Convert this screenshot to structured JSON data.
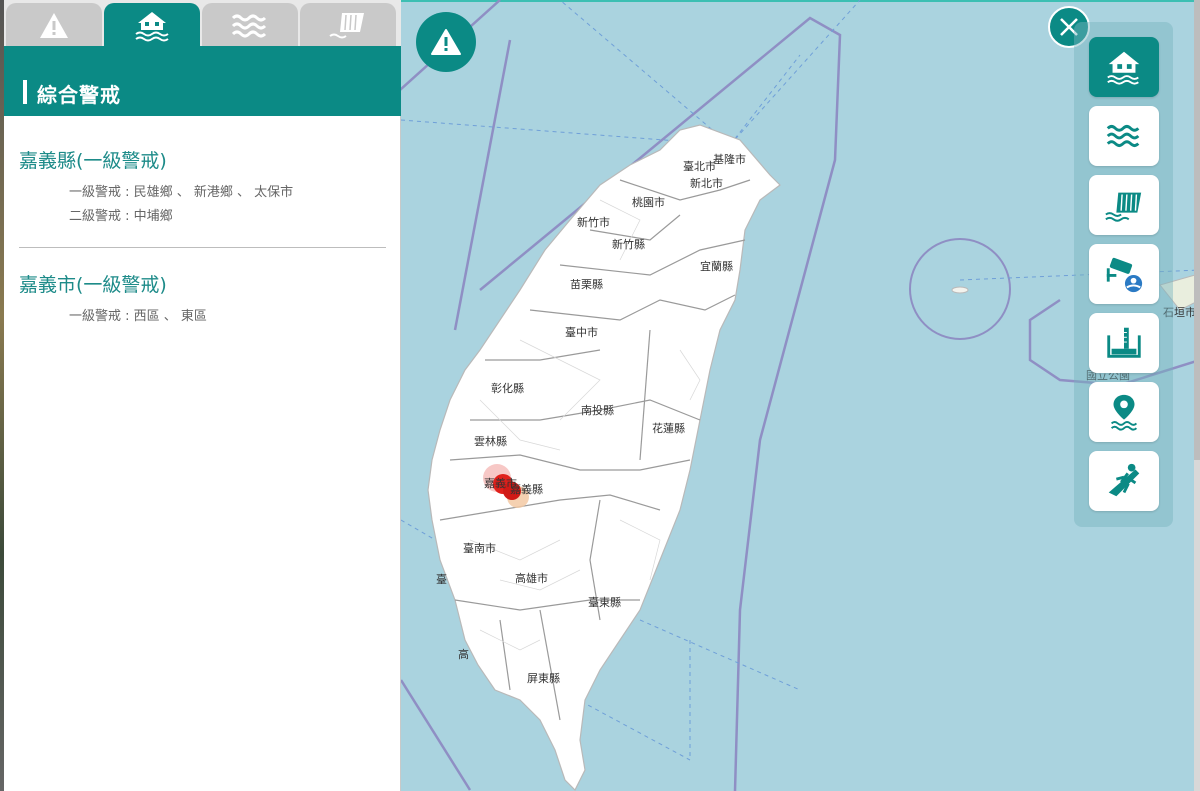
{
  "panel": {
    "header_title": "綜合警戒",
    "tabs": [
      {
        "name": "warning-tab",
        "icon": "warning-icon",
        "active": false
      },
      {
        "name": "flood-house-tab",
        "icon": "flood-house-icon",
        "active": true
      },
      {
        "name": "water-level-tab",
        "icon": "water-waves-icon",
        "active": false
      },
      {
        "name": "reservoir-tab",
        "icon": "reservoir-dam-icon",
        "active": false
      }
    ],
    "alerts": [
      {
        "title": "嘉義縣(一級警戒)",
        "lines": [
          "一級警戒 : 民雄鄉 、 新港鄉 、 太保市",
          "二級警戒 : 中埔鄉"
        ]
      },
      {
        "title": "嘉義市(一級警戒)",
        "lines": [
          "一級警戒 : 西區 、 東區"
        ]
      }
    ]
  },
  "map": {
    "county_labels": [
      "臺北市",
      "基隆市",
      "新北市",
      "桃園市",
      "新竹市",
      "新竹縣",
      "宜蘭縣",
      "苗栗縣",
      "臺中市",
      "彰化縣",
      "南投縣",
      "花蓮縣",
      "雲林縣",
      "嘉義市",
      "嘉義縣",
      "臺南市",
      "高雄市",
      "臺東縣",
      "屏東縣",
      "高",
      "臺",
      "石垣市",
      "國立公園"
    ],
    "colors": {
      "accent": "#0b8a85",
      "sea": "#aad3df",
      "land": "#ffffff",
      "alert_red": "#e0201b"
    }
  },
  "toolbar": {
    "tools": [
      {
        "name": "flood-house-tool",
        "icon": "flood-house-icon",
        "active": true
      },
      {
        "name": "water-waves-tool",
        "icon": "water-waves-icon",
        "active": false
      },
      {
        "name": "reservoir-tool",
        "icon": "reservoir-dam-icon",
        "active": false
      },
      {
        "name": "cctv-tool",
        "icon": "cctv-camera-icon",
        "active": false
      },
      {
        "name": "water-gauge-tool",
        "icon": "water-gauge-icon",
        "active": false
      },
      {
        "name": "location-water-tool",
        "icon": "location-water-icon",
        "active": false
      },
      {
        "name": "evacuation-tool",
        "icon": "evacuation-run-icon",
        "active": false
      }
    ]
  }
}
